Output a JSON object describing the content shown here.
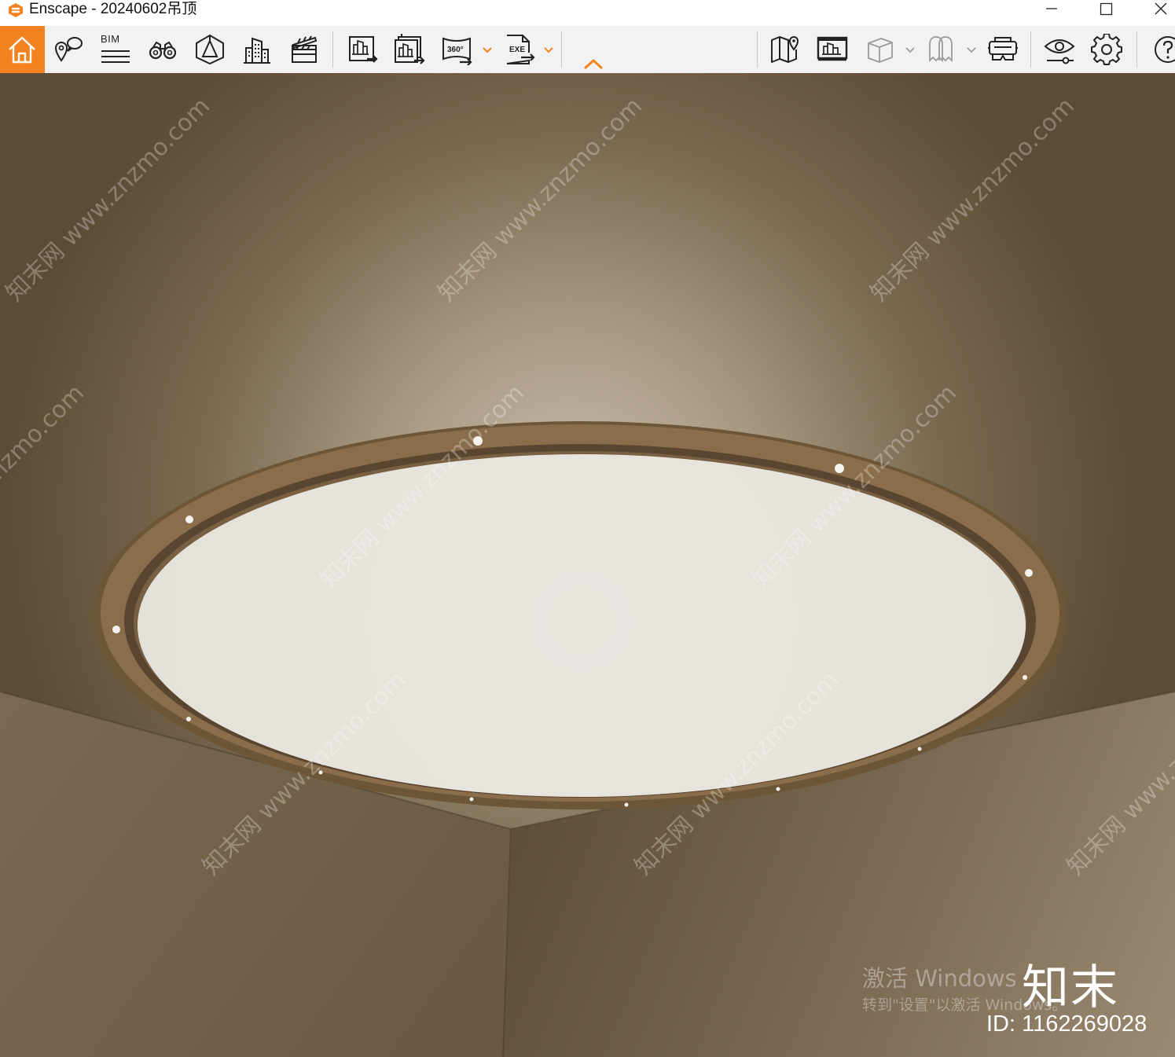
{
  "window": {
    "title": "Enscape - 20240602吊顶",
    "controls": [
      "minimize-icon",
      "maximize-icon",
      "close-icon"
    ]
  },
  "toolbar": {
    "accent_color": "#f58220",
    "bim_label": "BIM",
    "panorama_label": "360°",
    "exe_label": "EXE",
    "left_tools": [
      "home-icon",
      "location-pin-icon",
      "bim-list-icon",
      "binoculars-icon",
      "view-perspective-icon",
      "buildings-icon",
      "clapperboard-icon"
    ],
    "export_tools": [
      "render-image-icon",
      "batch-render-icon",
      "panorama-360-icon",
      "standalone-exe-icon"
    ],
    "right_tools": [
      "map-icon",
      "billboard-icon",
      "cube-icon",
      "ghost-icon",
      "vr-headset-icon",
      "visual-settings-eye-icon",
      "settings-gear-icon",
      "help-icon"
    ]
  },
  "viewport": {
    "scene": "ceiling-with-circular-light",
    "watermark_text": "知末网 www.znzmo.com",
    "windows_activation": {
      "title": "激活 Windows",
      "subtitle": "转到\"设置\"以激活 Windows。"
    },
    "brand_mark": "知末",
    "image_id": "ID: 1162269028"
  }
}
